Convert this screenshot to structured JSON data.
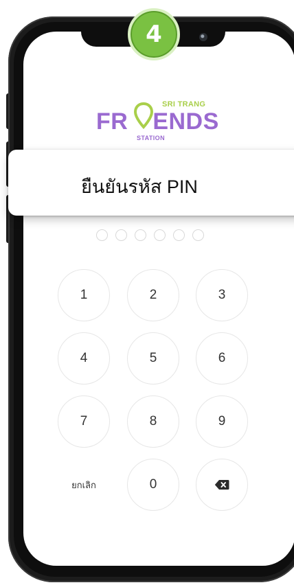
{
  "step_badge": "4",
  "logo": {
    "top_line": "SRI TRANG",
    "main_left": "FR",
    "main_right": "ENDS",
    "bottom_line": "STATION"
  },
  "title": "ยืนยันรหัส PIN",
  "pin": {
    "length": 6,
    "filled": 0
  },
  "keypad": {
    "keys": [
      "1",
      "2",
      "3",
      "4",
      "5",
      "6",
      "7",
      "8",
      "9"
    ],
    "cancel_label": "ยกเลิก",
    "zero": "0",
    "delete_icon": "backspace-icon"
  },
  "colors": {
    "badge_green": "#7ac142",
    "logo_purple": "#9a6ad0",
    "logo_lime": "#a9cf4a"
  }
}
